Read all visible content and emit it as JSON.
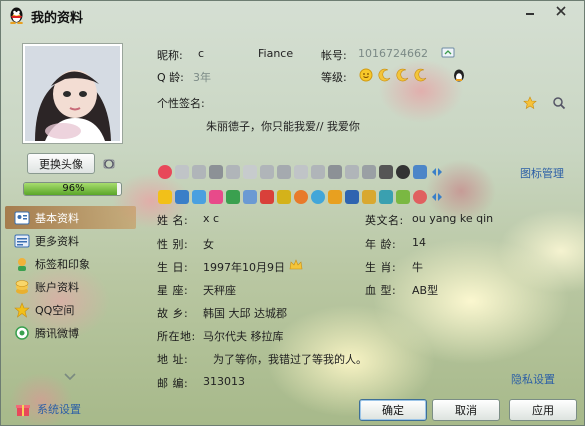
{
  "window": {
    "title": "我的资料"
  },
  "profile": {
    "change_avatar_label": "更换头像",
    "completion_percent": 96,
    "completion_text": "96%",
    "nickname_label": "昵称:",
    "nickname_value": "c",
    "nickname_extra": "Fiance",
    "account_label": "帐号:",
    "account_value": "1016724662",
    "q_age_label": "Q 龄:",
    "q_age_value": "3年",
    "level_label": "等级:",
    "signature_label": "个性签名:",
    "signature_value": "朱丽德子，你只能我爱// 我爱你"
  },
  "icon_manager_label": "图标管理",
  "nav": {
    "items": [
      {
        "label": "基本资料",
        "icon": "basic-info-icon",
        "active": true
      },
      {
        "label": "更多资料",
        "icon": "more-info-icon",
        "active": false
      },
      {
        "label": "标签和印象",
        "icon": "tags-icon",
        "active": false
      },
      {
        "label": "账户资料",
        "icon": "account-icon",
        "active": false
      },
      {
        "label": "QQ空间",
        "icon": "qzone-icon",
        "active": false
      },
      {
        "label": "腾讯微博",
        "icon": "weibo-icon",
        "active": false
      }
    ],
    "system_settings_label": "系统设置"
  },
  "details": {
    "name_label": "姓    名:",
    "name_value": "x c",
    "english_name_label": "英文名:",
    "english_name_value": "ou yang ke qin",
    "gender_label": "性    别:",
    "gender_value": "女",
    "age_label": "年    龄:",
    "age_value": "14",
    "birthday_label": "生    日:",
    "birthday_value": "1997年10月9日",
    "zodiac_label": "生    肖:",
    "zodiac_value": "牛",
    "constellation_label": "星    座:",
    "constellation_value": "天秤座",
    "blood_label": "血    型:",
    "blood_value": "AB型",
    "hometown_label": "故    乡:",
    "hometown_value": "韩国  大邱  达城郡",
    "location_label": "所在地:",
    "location_value": "马尔代夫  移拉库",
    "address_label": "地    址:",
    "address_value": "为了等你，我错过了等我的人。",
    "zip_label": "邮    编:",
    "zip_value": "313013"
  },
  "privacy_link_label": "隐私设置",
  "buttons": {
    "ok": "确定",
    "cancel": "取消",
    "apply": "应用"
  },
  "colors": {
    "accent": "#2c5fa6",
    "active_nav": "#b07a45",
    "progress": "#5aa629"
  }
}
